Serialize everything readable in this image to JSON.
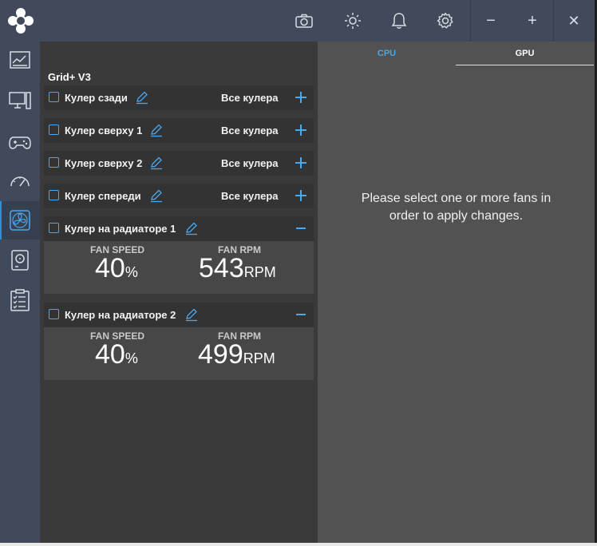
{
  "toolbar": {
    "icons": [
      "camera-icon",
      "brightness-icon",
      "bell-icon",
      "gear-icon"
    ],
    "window": {
      "minimize": "−",
      "maximize": "+",
      "close": "✕"
    }
  },
  "sidebar": {
    "items": [
      "dashboard-icon",
      "pc-icon",
      "gamepad-icon",
      "gauge-icon",
      "fan-icon",
      "storage-icon",
      "clipboard-icon"
    ],
    "active_index": 4
  },
  "panel": {
    "title": "Grid+ V3",
    "fans": [
      {
        "name": "Кулер сзади",
        "group": "Все кулера",
        "expanded": false
      },
      {
        "name": "Кулер сверху 1",
        "group": "Все кулера",
        "expanded": false
      },
      {
        "name": "Кулер сверху 2",
        "group": "Все кулера",
        "expanded": false
      },
      {
        "name": "Кулер спереди",
        "group": "Все кулера",
        "expanded": false
      },
      {
        "name": "Кулер на радиаторе 1",
        "expanded": true,
        "speed_label": "FAN SPEED",
        "speed": "40",
        "speed_unit": "%",
        "rpm_label": "FAN RPM",
        "rpm": "543",
        "rpm_unit": "RPM"
      },
      {
        "name": "Кулер на радиаторе 2",
        "expanded": true,
        "speed_label": "FAN SPEED",
        "speed": "40",
        "speed_unit": "%",
        "rpm_label": "FAN RPM",
        "rpm": "499",
        "rpm_unit": "RPM"
      }
    ]
  },
  "right_panel": {
    "tabs": [
      "CPU",
      "GPU"
    ],
    "active_tab": "GPU",
    "message": "Please select one or more fans in order to apply changes."
  },
  "colors": {
    "accent": "#4aa8ee",
    "sidebar": "#404a5a",
    "panel": "#3a3a3a",
    "right_panel": "#525252"
  }
}
